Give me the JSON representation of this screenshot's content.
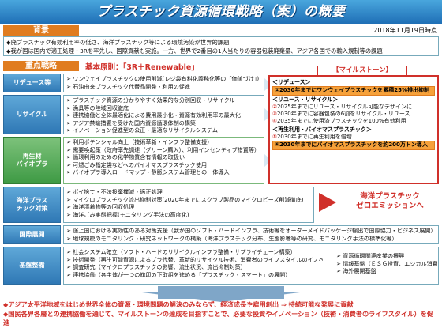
{
  "title": "プラスチック資源循環戦略（案）の概要",
  "background": {
    "label": "背景",
    "date": "2018年11月19日時点",
    "items": [
      "◆廃プラスチック有効利用率の低さ、海洋プラスチック等による環境汚染が世界的課題",
      "◆我が国は国内で適正処理・3Rを率先し、国際貢献も実施。一方、世界で2番目の1人当たりの容器包装廃棄量、アジア各国での輸入規制等の課題"
    ]
  },
  "focus": {
    "label": "重点戦略",
    "principle": "基本原則：「3R＋Renewable」"
  },
  "rows": [
    {
      "label": "リデュース等",
      "items": [
        "➢ ワンウェイプラスチックの使用削減(レジ袋有料化義務化等の「価値づけ」)",
        "➢ 石油由来プラスチック代替品開発・利用の促進"
      ]
    },
    {
      "label": "リサイクル",
      "items": [
        "➢ プラスチック資源の分かりやすく効果的な分別回収・リサイクル",
        "➢ 漁具等の陸域回収徹底",
        "➢ 連携協働と全体最適化による費用最小化・資源有効利用率の最大化",
        "➢ アジア禁輸措置を受けた国内資源循環体制の構築",
        "➢ イノベーション促進型の公正・最適なリサイクルシステム"
      ]
    },
    {
      "label": "再生材\nバイオプラ",
      "items": [
        "➢ 利用ポテンシャル向上（技術革新・インフラ整備支援）",
        "➢ 需要喚起策（政府率先調達（グリーン購入）、利用インセンティブ措置等）",
        "➢ 循環利用のための化学物質含有情報の取扱い",
        "➢ 可燃ごみ指定袋などへのバイオマスプラスチック使用",
        "➢ バイオプラ導入ロードマップ・静脈システム管理との一体導入"
      ]
    },
    {
      "label": "海洋プラス\nチック対策",
      "items": [
        "➢ ポイ捨て・不法投棄撲滅・適正処理",
        "➢ マイクロプラスチック流出抑制対策(2020年までにスクラブ製品のマイクロビーズ削減徹底)",
        "➢ 海洋漂着物等の回収処理",
        "➢ 海洋ごみ実態把握(モニタリング手法の高度化)"
      ]
    },
    {
      "label": "国際展開",
      "items": [
        "➢ 途上国における実効性のある対策支援（我が国のソフト・ハードインフラ、技術等をオーダーメイドパッケージ輸出で国際協力・ビジネス展開）",
        "➢ 地球規模のモニタリング・研究ネットワークの構築（海洋プラスチック分布、生態影響等の研究、モニタリング手法の標準化等）"
      ]
    },
    {
      "label": "基盤整備",
      "items": [
        "➢ 社会システム確立（ソフト・ハードのリサイクルインフラ整備・サプライチェーン構築）",
        "➢ 技術開発（再生可能資源によるプラ代替、革新的リサイクル技術、消費者のライフスタイルのイノベーション）",
        "➢ 調査研究（マイクロプラスチックの影響、流出状況、流出抑制対策）",
        "➢ 連携協働（各主体が一つの旗印の下取組を進める「プラスチック・スマート」の展開）"
      ],
      "side_items": [
        "➢ 資源循環関連産業の振興",
        "➢ 情報基盤（ＥＳＧ投資、エシカル消費）",
        "➢ 海外展開基盤"
      ]
    }
  ],
  "milestone": {
    "label": "【マイルストーン】",
    "sections": [
      {
        "head": "＜リデュース＞",
        "items": [
          {
            "num": "①",
            "text": "2030年までにワンウェイプラスチックを累積25%排出抑制",
            "highlight": true
          }
        ]
      },
      {
        "head": "＜リユース・リサイクル＞",
        "items": [
          {
            "num": "②",
            "text": "2025年までにリユース・リサイクル可能なデザインに",
            "highlight": false
          },
          {
            "num": "③",
            "text": "2030年までに容器包装の6割をリサイクル・リユース",
            "highlight": false
          },
          {
            "num": "④",
            "text": "2035年までに使用済プラスチックを100%有効利用",
            "highlight": false
          }
        ]
      },
      {
        "head": "＜再生利用・バイオマスプラスチック＞",
        "items": [
          {
            "num": "⑤",
            "text": "2030年までに再生利用を倍増",
            "highlight": false
          },
          {
            "num": "⑥",
            "text": "2030年までにバイオマスプラスチックを約200万トン導入",
            "highlight": true
          }
        ]
      }
    ]
  },
  "marine_zero": "海洋プラスチック\nゼロエミッションへ",
  "goals": [
    "◆アジア太平洋地域をはじめ世界全体の資源・環境問題の解決のみならず、経済成長や雇用創出 ⇒ 持続可能な発展に貢献",
    "◆国民各界各層との連携協働を通じて、マイルストーンの達成を目指すことで、必要な投資やイノベーション（技術・消費者のライフスタイル）を促進"
  ],
  "colors": {
    "title_band": "#1f6fb6",
    "section_label": "#e07c1f",
    "accent_red": "#d0302a",
    "row_label_blue": "#2f78b5",
    "row_label_green": "#3e9a44",
    "milestone_highlight": "#f6a13a"
  }
}
